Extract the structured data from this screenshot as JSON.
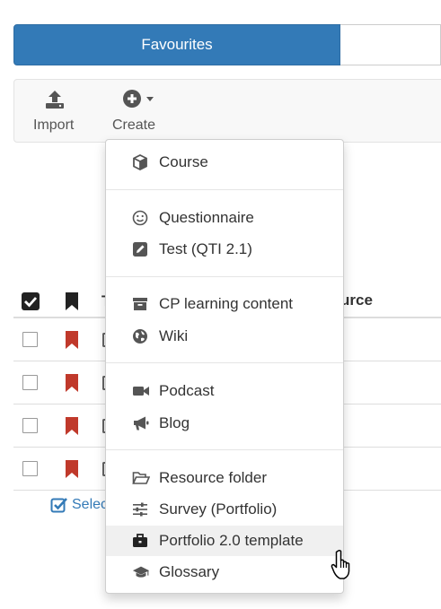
{
  "tabs": {
    "active_label": "Favourites"
  },
  "toolbar": {
    "import_label": "Import",
    "create_label": "Create"
  },
  "table": {
    "header_source_stub": "urce",
    "header_title_stub": "T"
  },
  "select_link": {
    "label": "Selec"
  },
  "dropdown": {
    "items": [
      {
        "label": "Course",
        "icon": "cube-icon"
      },
      {
        "label": "Questionnaire",
        "icon": "smiley-icon"
      },
      {
        "label": "Test (QTI 2.1)",
        "icon": "edit-icon"
      },
      {
        "label": "CP learning content",
        "icon": "archive-icon"
      },
      {
        "label": "Wiki",
        "icon": "globe-icon"
      },
      {
        "label": "Podcast",
        "icon": "video-camera-icon"
      },
      {
        "label": "Blog",
        "icon": "bullhorn-icon"
      },
      {
        "label": "Resource folder",
        "icon": "folder-open-icon"
      },
      {
        "label": "Survey (Portfolio)",
        "icon": "sliders-icon"
      },
      {
        "label": "Portfolio 2.0 template",
        "icon": "briefcase-icon"
      },
      {
        "label": "Glossary",
        "icon": "graduation-cap-icon"
      }
    ]
  },
  "colors": {
    "primary": "#337ab7",
    "bookmark": "#c0392b",
    "icon_gray": "#555555"
  }
}
